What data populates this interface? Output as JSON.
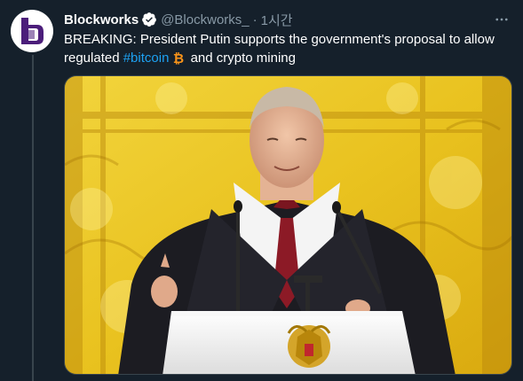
{
  "tweet": {
    "display_name": "Blockworks",
    "handle": "@Blockworks_",
    "separator": "·",
    "timestamp": "1시간",
    "text_part1": "BREAKING: President Putin supports the government's proposal to allow regulated ",
    "hashtag": "#bitcoin",
    "emoji": "bitcoin-emoji",
    "text_part2": " and crypto mining",
    "verified": true
  },
  "icons": {
    "avatar": "blockworks-logo-icon",
    "verified": "verified-badge-icon",
    "more": "more-options-icon"
  },
  "colors": {
    "background": "#15202b",
    "text": "#ffffff",
    "secondary_text": "#8899a6",
    "link": "#1da1f2",
    "verified": "#1da1f2",
    "bitcoin": "#f7931a",
    "logo": "#4b1d7a"
  }
}
